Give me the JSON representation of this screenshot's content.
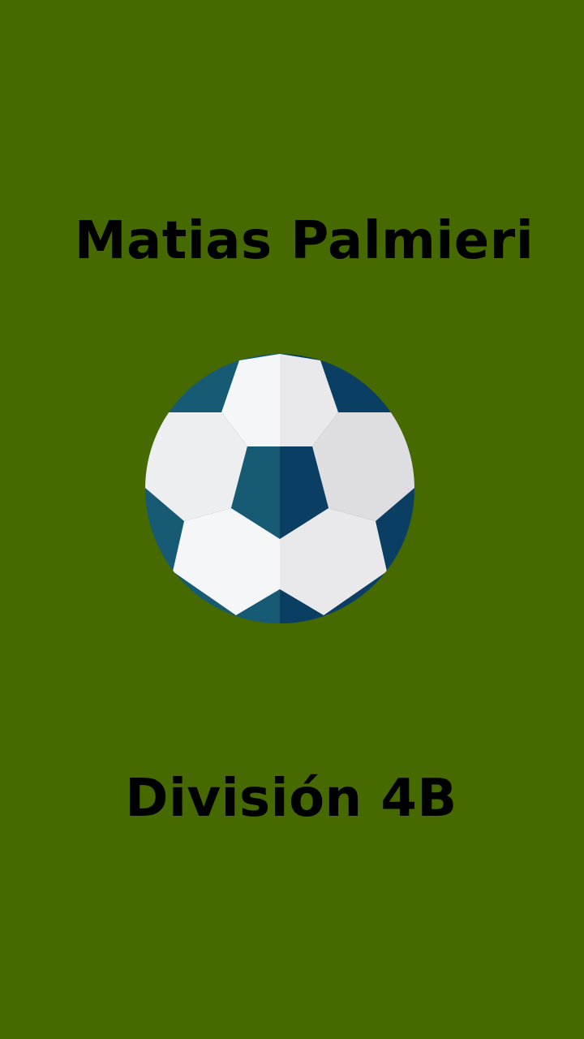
{
  "player": {
    "name": "Matias Palmieri"
  },
  "league": {
    "division": "División 4B"
  },
  "ball": {
    "icon": "soccer-ball-icon"
  },
  "colors": {
    "background": "#466a00",
    "text": "#000000",
    "ball_panel_dark": "#0a3f63",
    "ball_panel_mid": "#175a74",
    "ball_white": "#f4f6f8",
    "ball_gray": "#e9e9ec"
  }
}
